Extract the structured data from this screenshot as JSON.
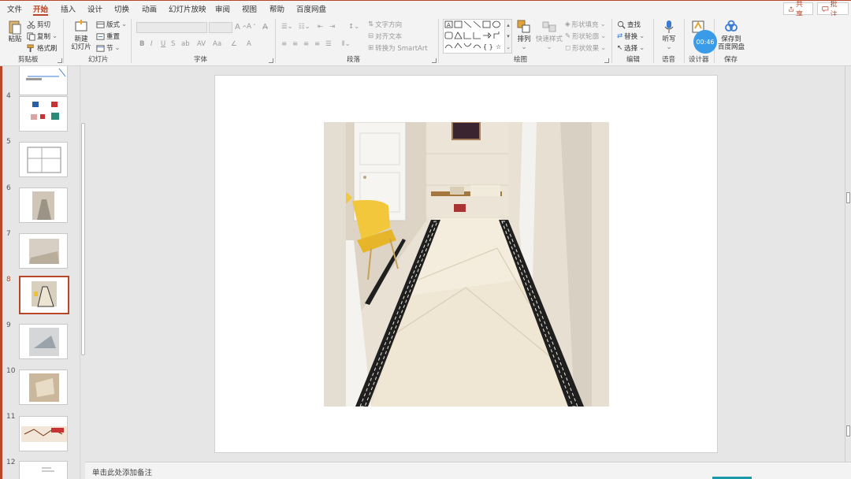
{
  "tabs": [
    "文件",
    "开始",
    "插入",
    "设计",
    "切换",
    "动画",
    "幻灯片放映",
    "审阅",
    "视图",
    "帮助",
    "百度网盘"
  ],
  "active_tab": "开始",
  "share_label": "共享",
  "comment_label": "批注",
  "clipboard": {
    "paste": "粘贴",
    "cut": "剪切",
    "copy": "复制",
    "format_painter": "格式刷",
    "group": "剪贴板"
  },
  "slides_group": {
    "new_slide_line1": "新建",
    "new_slide_line2": "幻灯片",
    "layout": "版式",
    "reset": "重置",
    "section": "节",
    "group": "幻灯片"
  },
  "font_group": {
    "bold": "B",
    "italic": "I",
    "underline": "U",
    "strike": "S",
    "shadow": "ab",
    "group": "字体"
  },
  "paragraph_group": {
    "text_direction": "文字方向",
    "align_text": "对齐文本",
    "convert_smartart": "转换为 SmartArt",
    "group": "段落"
  },
  "drawing_group": {
    "arrange": "排列",
    "quick_styles": "快速样式",
    "shape_fill": "形状填充",
    "shape_outline": "形状轮廓",
    "shape_effects": "形状效果",
    "group": "绘图"
  },
  "editing_group": {
    "find": "查找",
    "replace": "替换",
    "select": "选择",
    "group": "编辑"
  },
  "voice_group": {
    "dictate": "听写",
    "group": "语音"
  },
  "designer_group": {
    "designer_line1": "设",
    "designer_line2": "计",
    "group": "设计器"
  },
  "save_group": {
    "save_line1": "保存到",
    "save_line2": "百度网盘",
    "group": "保存"
  },
  "timer": "00:46",
  "slide_numbers": [
    "4",
    "5",
    "6",
    "7",
    "8",
    "9",
    "10",
    "11",
    "12"
  ],
  "active_slide": "8",
  "notes_placeholder": "单击此处添加备注",
  "colors": {
    "accent": "#b7472a",
    "background": "#e6e6e6",
    "ribbon": "#f3f3f3"
  }
}
